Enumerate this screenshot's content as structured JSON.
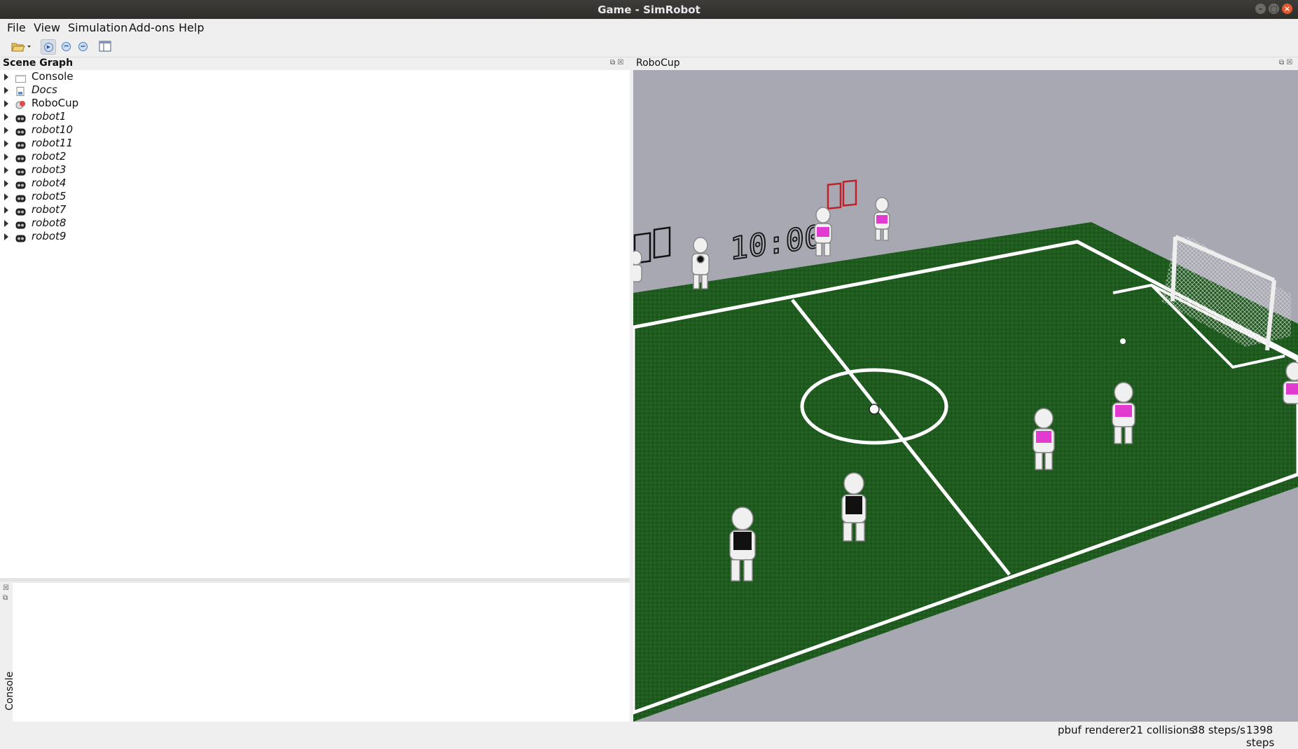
{
  "window": {
    "title": "Game - SimRobot"
  },
  "menu": [
    "File",
    "View",
    "Simulation",
    "Add-ons",
    "Help"
  ],
  "scene_graph": {
    "title": "Scene Graph",
    "items": [
      {
        "label": "Console",
        "icon": "console-icon",
        "italic": false
      },
      {
        "label": "Docs",
        "icon": "docs-icon",
        "italic": true
      },
      {
        "label": "RoboCup",
        "icon": "robocup-icon",
        "italic": false
      },
      {
        "label": "robot1",
        "icon": "robot-icon",
        "italic": true
      },
      {
        "label": "robot10",
        "icon": "robot-icon",
        "italic": true
      },
      {
        "label": "robot11",
        "icon": "robot-icon",
        "italic": true
      },
      {
        "label": "robot2",
        "icon": "robot-icon",
        "italic": true
      },
      {
        "label": "robot3",
        "icon": "robot-icon",
        "italic": true
      },
      {
        "label": "robot4",
        "icon": "robot-icon",
        "italic": true
      },
      {
        "label": "robot5",
        "icon": "robot-icon",
        "italic": true
      },
      {
        "label": "robot7",
        "icon": "robot-icon",
        "italic": true
      },
      {
        "label": "robot8",
        "icon": "robot-icon",
        "italic": true
      },
      {
        "label": "robot9",
        "icon": "robot-icon",
        "italic": true
      }
    ]
  },
  "console": {
    "tab_label": "Console"
  },
  "view3d": {
    "title": "RoboCup",
    "clock": "10:00",
    "colors": {
      "field": "#1f5d1f",
      "wall": "#a6a6b3",
      "team_pink": "#e23bd0",
      "team_black": "#111111"
    }
  },
  "status": {
    "renderer": "pbuf renderer",
    "collisions": "21 collisions",
    "rate": "38 steps/s",
    "steps": "1398 steps"
  }
}
